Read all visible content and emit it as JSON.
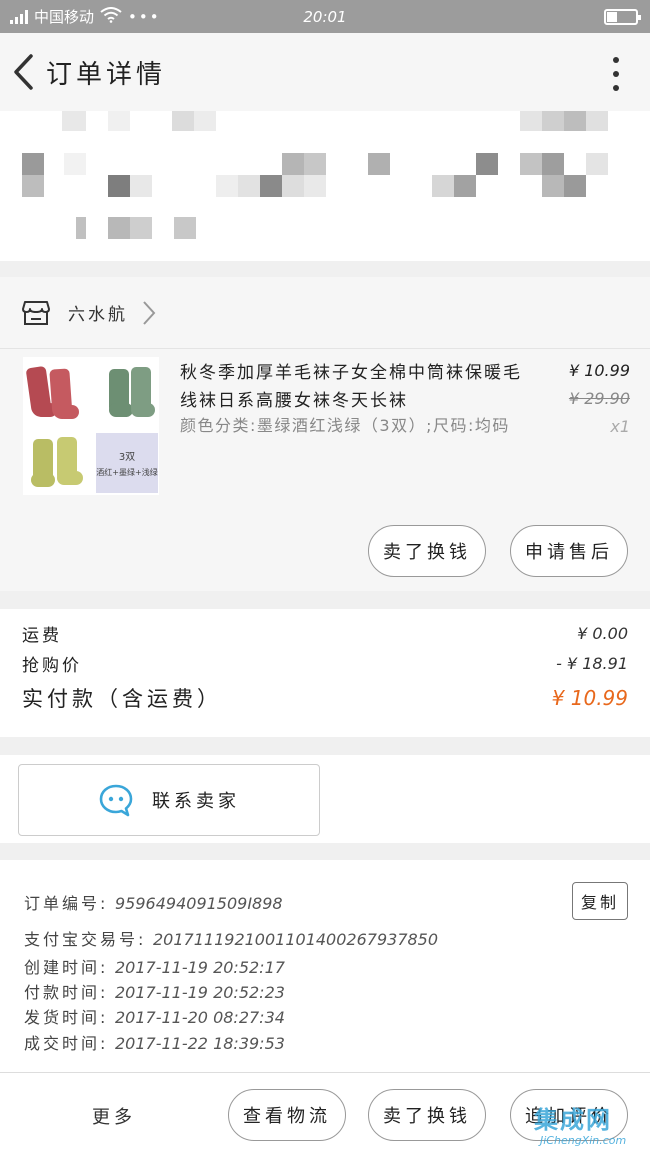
{
  "status_bar": {
    "carrier": "中国移动",
    "time": "20:01",
    "battery_level": 0.35,
    "network": "4G"
  },
  "header": {
    "title": "订单详情"
  },
  "shop": {
    "name": "六水航"
  },
  "product": {
    "title": "秋冬季加厚羊毛袜子女全棉中筒袜保暖毛线袜日系高腰女袜冬天长袜",
    "sku": "颜色分类:墨绿酒红浅绿（3双）;尺码:均码",
    "price": "¥ 10.99",
    "original_price": "¥ 29.90",
    "quantity": "x1",
    "thumbnail_caption_qty": "3双",
    "thumbnail_caption": "酒红+墨绿+浅绿",
    "buttons": {
      "buy_again": "卖了换钱",
      "after_sale": "申请售后"
    }
  },
  "summary": {
    "shipping_label": "运费",
    "shipping_value": "¥ 0.00",
    "discount_label": "抢购价",
    "discount_value": "- ¥ 18.91",
    "total_label": "实付款（含运费）",
    "total_value": "¥ 10.99"
  },
  "contact": {
    "label": "联系卖家"
  },
  "order_info": {
    "copy_label": "复制",
    "rows": [
      {
        "label": "订单编号:",
        "value": "9596494091509I898"
      },
      {
        "label": "支付宝交易号:",
        "value": "2017111921001101400267937850"
      },
      {
        "label": "创建时间:",
        "value": "2017-11-19 20:52:17"
      },
      {
        "label": "付款时间:",
        "value": "2017-11-19 20:52:23"
      },
      {
        "label": "发货时间:",
        "value": "2017-11-20 08:27:34"
      },
      {
        "label": "成交时间:",
        "value": "2017-11-22 18:39:53"
      }
    ]
  },
  "bottom_bar": {
    "more": "更多",
    "logistics": "查看物流",
    "sell": "卖了换钱",
    "review": "追加评价"
  },
  "watermark": {
    "main": "集成网",
    "sub": "JiChengXin.com"
  },
  "colors": {
    "accent_orange": "#e8681c",
    "status_bar": "#9c9c9c",
    "contact_icon": "#3aa6d9"
  }
}
